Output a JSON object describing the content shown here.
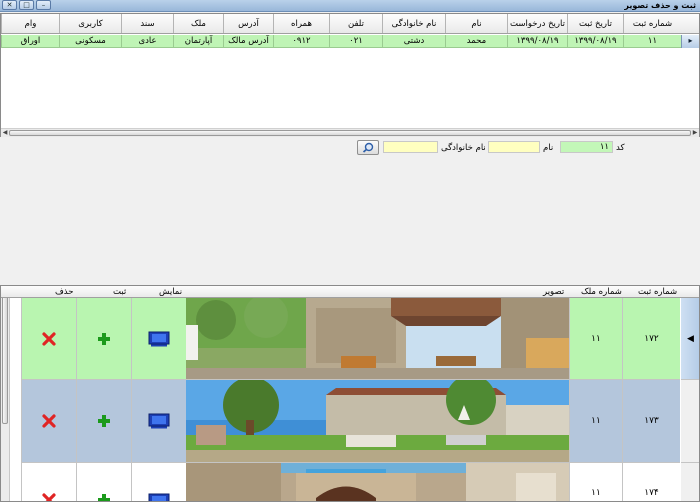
{
  "window": {
    "title": "ثبت و حذف تصویر"
  },
  "top_grid": {
    "columns": [
      "شماره ثبت",
      "تاریخ ثبت",
      "تاریخ درخواست",
      "نام",
      "نام خانوادگی",
      "تلفن",
      "همراه",
      "آدرس",
      "ملک",
      "سند",
      "کاربری",
      "وام"
    ],
    "rows": [
      [
        "۱۱",
        "۱۳۹۹/۰۸/۱۹",
        "۱۳۹۹/۰۸/۱۹",
        "محمد",
        "دشتی",
        "۰۲۱",
        "۰۹۱۲",
        "آدرس مالک",
        "آپارتمان",
        "عادی",
        "مسکونی",
        "اوراق"
      ]
    ],
    "row_indicator": "▸"
  },
  "search": {
    "code_label": "کد",
    "code_value": "۱۱",
    "name_label": "نام",
    "name_value": "",
    "family_label": "نام خانوادگی",
    "family_value": ""
  },
  "image_grid": {
    "columns": {
      "reg_no": "شماره ثبت",
      "property_no": "شماره ملک",
      "image": "تصویر",
      "show": "نمایش",
      "register": "ثبت",
      "delete": "حذف"
    },
    "rows": [
      {
        "reg_no": "۱۷۲",
        "property_no": "۱۱",
        "state": "selected"
      },
      {
        "reg_no": "۱۷۳",
        "property_no": "۱۱",
        "state": "alt"
      },
      {
        "reg_no": "۱۷۴",
        "property_no": "۱۱",
        "state": "normal"
      }
    ],
    "colors": {
      "selected": "#b9f5b0",
      "alt": "#b4c6dc",
      "normal": "#ffffff"
    },
    "icons": {
      "show": "monitor-icon",
      "register": "plus-icon",
      "delete": "delete-x-icon"
    }
  }
}
